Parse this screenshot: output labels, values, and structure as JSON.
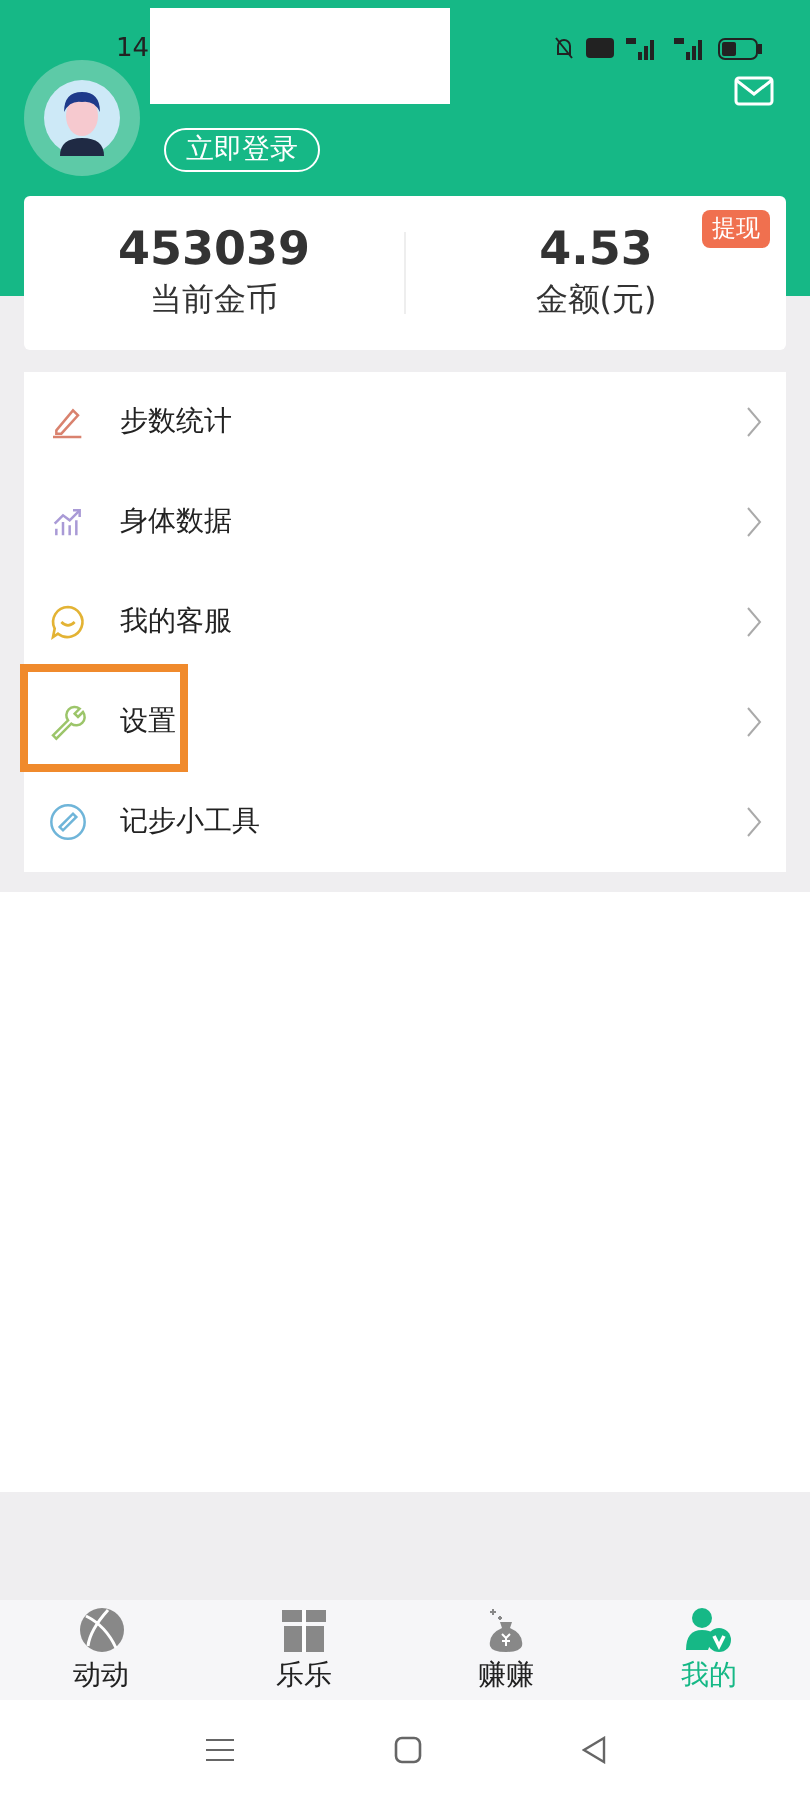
{
  "status_bar": {
    "time": "14"
  },
  "profile": {
    "login_button": "立即登录"
  },
  "stats": [
    {
      "value": "453039",
      "label": "当前金币"
    },
    {
      "value": "4.53",
      "label": "金额(元)",
      "badge": "提现"
    }
  ],
  "menu": [
    {
      "label": "步数统计",
      "kind": "pencil",
      "highlighted": false
    },
    {
      "label": "身体数据",
      "kind": "chart",
      "highlighted": false
    },
    {
      "label": "我的客服",
      "kind": "chat",
      "highlighted": false
    },
    {
      "label": "设置",
      "kind": "wrench",
      "highlighted": true
    },
    {
      "label": "记步小工具",
      "kind": "ruler",
      "highlighted": false
    }
  ],
  "tab_bar": [
    {
      "label": "动动",
      "kind": "ball",
      "selected": false
    },
    {
      "label": "乐乐",
      "kind": "gift",
      "selected": false
    },
    {
      "label": "赚赚",
      "kind": "bag",
      "selected": false
    },
    {
      "label": "我的",
      "kind": "user",
      "selected": true
    }
  ]
}
